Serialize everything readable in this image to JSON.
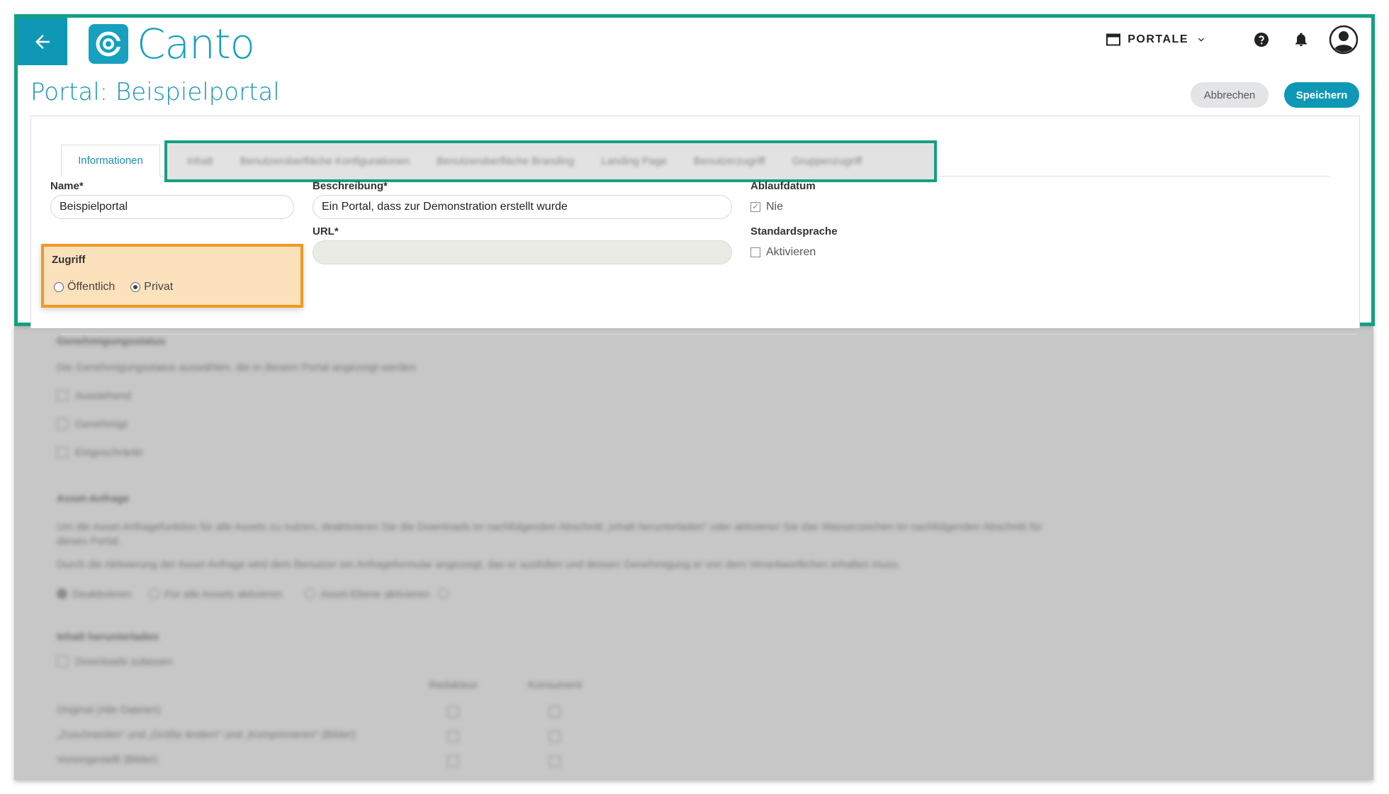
{
  "header": {
    "brand": "Canto",
    "portale_label": "PORTALE",
    "icons": {
      "back": "arrow-left-icon",
      "portale": "window-icon",
      "chevron": "chevron-down-icon",
      "help": "help-circle-icon",
      "notifications": "bell-icon",
      "account": "account-circle-icon"
    }
  },
  "page": {
    "title": "Portal: Beispielportal",
    "cancel_label": "Abbrechen",
    "save_label": "Speichern"
  },
  "tabs": {
    "active": "Informationen",
    "others": [
      "Inhalt",
      "Benutzeroberfläche Konfigurationen",
      "Benutzeroberfläche Branding",
      "Landing Page",
      "Benutzerzugriff",
      "Gruppenzugriff"
    ]
  },
  "form": {
    "name": {
      "label": "Name*",
      "value": "Beispielportal"
    },
    "description": {
      "label": "Beschreibung*",
      "value": "Ein Portal, dass zur Demonstration erstellt wurde"
    },
    "expiry": {
      "label": "Ablaufdatum",
      "option": "Nie",
      "checked": true
    },
    "access": {
      "label": "Zugriff",
      "options": [
        "Öffentlich",
        "Privat"
      ],
      "selected": "Privat"
    },
    "url": {
      "label": "URL*",
      "value": ""
    },
    "default_language": {
      "label": "Standardsprache",
      "option": "Aktivieren",
      "checked": false
    }
  },
  "blurred": {
    "approval": {
      "heading": "Genehmigungsstatus",
      "description": "Die Genehmigungsstatus auswählen, die in diesem Portal angezeigt werden",
      "options": [
        "Ausstehend",
        "Genehmigt",
        "Eingeschränkt"
      ]
    },
    "asset_request": {
      "heading": "Asset-Anfrage",
      "description_1": "Um die Asset-Anfragefunktion für alle Assets zu nutzen, deaktivieren Sie die Downloads im nachfolgenden Abschnitt „Inhalt herunterladen“ oder aktivieren Sie das Wasserzeichen im nachfolgenden Abschnitt für",
      "description_1b": "dieses Portal.",
      "description_2": "Durch die Aktivierung der Asset-Anfrage wird dem Benutzer ein Anfrageformular angezeigt, das er ausfüllen und dessen Genehmigung er von dem Verantwortlichen erhalten muss.",
      "options": [
        "Deaktivieren",
        "Für alle Assets aktivieren",
        "Asset-Ebene aktivieren"
      ]
    },
    "download": {
      "heading": "Inhalt herunterladen",
      "toggle": "Downloads zulassen",
      "columns": [
        "Redakteur",
        "Konsument"
      ],
      "rows": [
        "Original (Alle Dateien)",
        "„Zuschneiden“ und „Größe ändern“ und „Komprimieren“ (Bilder)",
        "Voreingestellt (Bilder)"
      ]
    }
  }
}
